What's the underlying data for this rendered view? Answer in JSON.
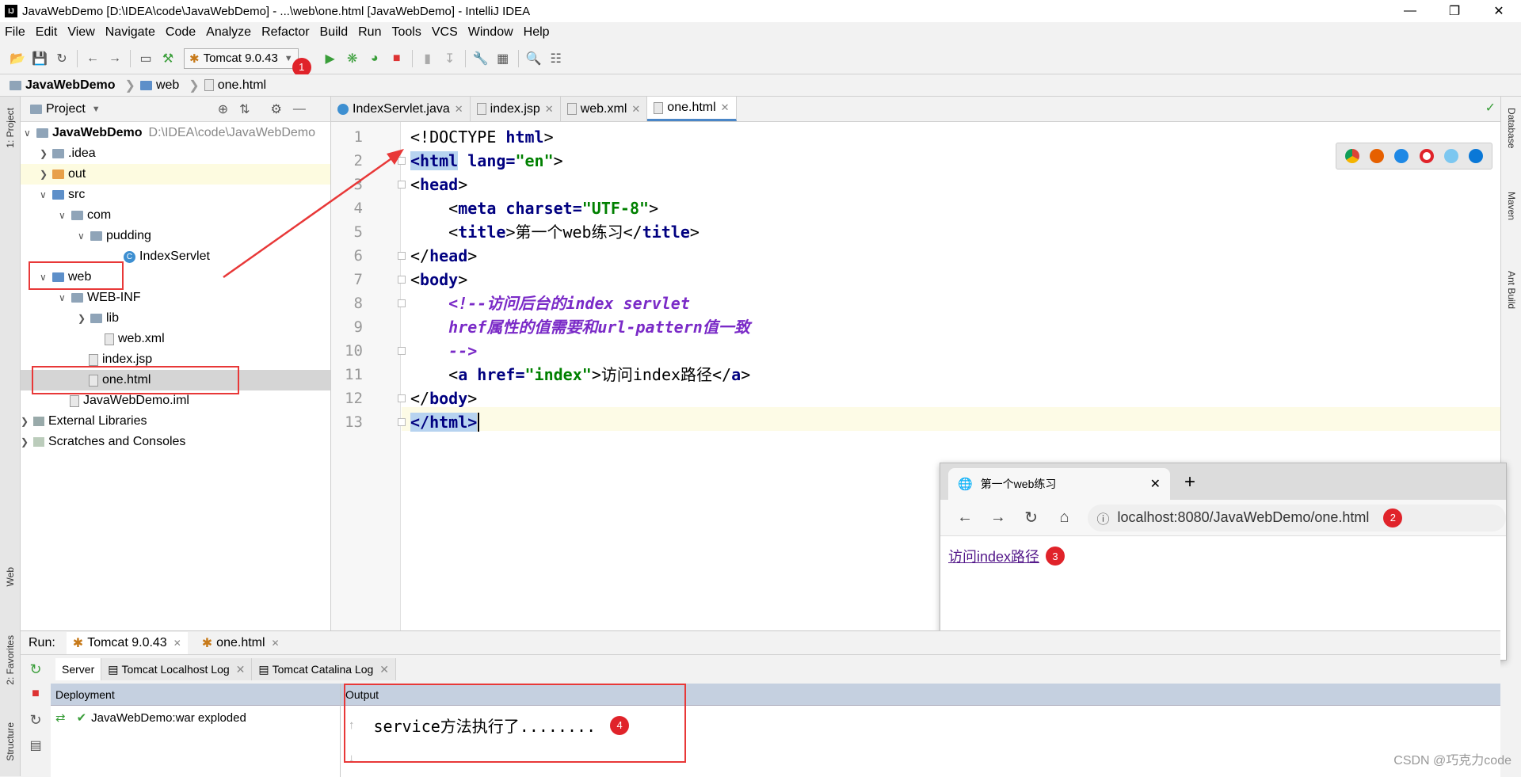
{
  "window": {
    "title": "JavaWebDemo [D:\\IDEA\\code\\JavaWebDemo] - ...\\web\\one.html [JavaWebDemo] - IntelliJ IDEA",
    "app_icon": "IJ"
  },
  "menu": [
    "File",
    "Edit",
    "View",
    "Navigate",
    "Code",
    "Analyze",
    "Refactor",
    "Build",
    "Run",
    "Tools",
    "VCS",
    "Window",
    "Help"
  ],
  "toolbar": {
    "run_config": "Tomcat 9.0.43",
    "badge1": "1"
  },
  "breadcrumb": [
    "JavaWebDemo",
    "web",
    "one.html"
  ],
  "project": {
    "header": "Project",
    "root_name": "JavaWebDemo",
    "root_path": "D:\\IDEA\\code\\JavaWebDemo",
    "items": [
      ".idea",
      "out",
      "src",
      "com",
      "pudding",
      "IndexServlet",
      "web",
      "WEB-INF",
      "lib",
      "web.xml",
      "index.jsp",
      "one.html",
      "JavaWebDemo.iml",
      "External Libraries",
      "Scratches and Consoles"
    ]
  },
  "editor": {
    "tabs": [
      "IndexServlet.java",
      "index.jsp",
      "web.xml",
      "one.html"
    ],
    "line_numbers": [
      "1",
      "2",
      "3",
      "4",
      "5",
      "6",
      "7",
      "8",
      "9",
      "10",
      "11",
      "12",
      "13"
    ],
    "code": {
      "l1_a": "<!DOCTYPE ",
      "l1_b": "html",
      "l1_c": ">",
      "l2_a": "<html",
      "l2_b": " lang=",
      "l2_c": "\"en\"",
      "l2_d": ">",
      "l3_a": "<",
      "l3_b": "head",
      "l3_c": ">",
      "l4_a": "    <",
      "l4_b": "meta charset=",
      "l4_c": "\"UTF-8\"",
      "l4_d": ">",
      "l5_a": "    <",
      "l5_b": "title",
      "l5_c": ">第一个web练习</",
      "l5_d": "title",
      "l5_e": ">",
      "l6_a": "</",
      "l6_b": "head",
      "l6_c": ">",
      "l7_a": "<",
      "l7_b": "body",
      "l7_c": ">",
      "l8": "    <!--访问后台的index servlet",
      "l9": "    href属性的值需要和url-pattern值一致",
      "l10": "    -->",
      "l11_a": "    <",
      "l11_b": "a href=",
      "l11_c": "\"index\"",
      "l11_d": ">访问index路径</",
      "l11_e": "a",
      "l11_f": ">",
      "l12_a": "</",
      "l12_b": "body",
      "l12_c": ">",
      "l13": "</html>"
    }
  },
  "browser": {
    "tab_title": "第一个web练习",
    "url": "localhost:8080/JavaWebDemo/one.html",
    "link_text": "访问index路径",
    "badge2": "2",
    "badge3": "3"
  },
  "right_tools": [
    "Database",
    "Maven",
    "Ant Build"
  ],
  "left_tools": [
    "1: Project",
    "Web",
    "2: Favorites",
    "Structure"
  ],
  "run": {
    "label": "Run:",
    "tabs": [
      "Tomcat 9.0.43",
      "one.html"
    ],
    "subtabs": [
      "Server",
      "Tomcat Localhost Log",
      "Tomcat Catalina Log"
    ],
    "deployment_header": "Deployment",
    "output_header": "Output",
    "deployment_item": "JavaWebDemo:war exploded",
    "output_text": "service方法执行了........",
    "badge4": "4"
  },
  "watermark": "CSDN @巧克力code",
  "colors": {
    "accent_red": "#e0232a",
    "selection_blue": "#b7d3f0",
    "keyword": "#000080",
    "string": "#008000",
    "comment": "#7a2ac7"
  }
}
